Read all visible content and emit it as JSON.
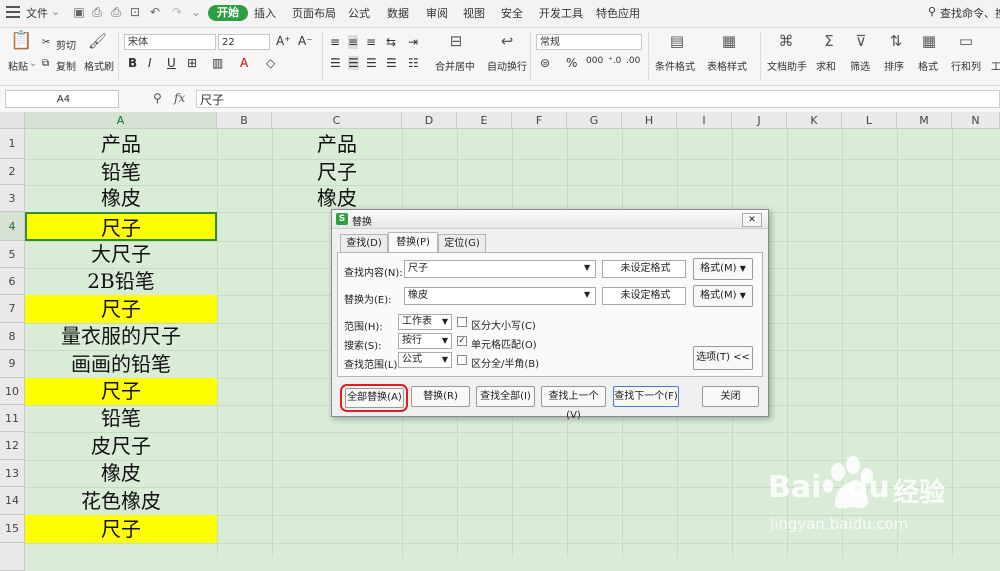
{
  "menubar": {
    "file_label": "文件",
    "tabs": [
      "开始",
      "插入",
      "页面布局",
      "公式",
      "数据",
      "审阅",
      "视图",
      "安全",
      "开发工具",
      "特色应用"
    ],
    "search_label": "查找命令、搜"
  },
  "ribbon": {
    "paste": "粘贴",
    "cut": "剪切",
    "copy": "复制",
    "format_painter": "格式刷",
    "font_name": "宋体",
    "font_size": "22",
    "merge_center": "合并居中",
    "wrap_text": "自动换行",
    "number_format": "常规",
    "conditional_format": "条件格式",
    "table_style": "表格样式",
    "doc_helper": "文档助手",
    "sum": "求和",
    "filter": "筛选",
    "sort": "排序",
    "format": "格式",
    "rows_cols": "行和列",
    "tools": "工"
  },
  "formula_bar": {
    "name_box": "A4",
    "fx": "fx",
    "content": "尺子"
  },
  "grid": {
    "columns": [
      "A",
      "B",
      "C",
      "D",
      "E",
      "F",
      "G",
      "H",
      "I",
      "J",
      "K",
      "L",
      "M",
      "N"
    ],
    "rows": [
      "1",
      "2",
      "3",
      "4",
      "5",
      "6",
      "7",
      "8",
      "9",
      "10",
      "11",
      "12",
      "13",
      "14",
      "15",
      ""
    ],
    "col_a": [
      "产品",
      "铅笔",
      "橡皮",
      "尺子",
      "大尺子",
      "2B铅笔",
      "尺子",
      "量衣服的尺子",
      "画画的铅笔",
      "尺子",
      "铅笔",
      "皮尺子",
      "橡皮",
      "花色橡皮",
      "尺子"
    ],
    "col_c": [
      "产品",
      "尺子",
      "橡皮"
    ],
    "highlight_color": "#ffff00",
    "selected_cell": "A4"
  },
  "dialog": {
    "title": "替换",
    "tabs": [
      "查找(D)",
      "替换(P)",
      "定位(G)"
    ],
    "find_label": "查找内容(N):",
    "find_value": "尺子",
    "replace_label": "替换为(E):",
    "replace_value": "橡皮",
    "no_format": "未设定格式",
    "format_btn": "格式(M)",
    "scope_label": "范围(H):",
    "scope_value": "工作表",
    "search_label": "搜索(S):",
    "search_value": "按行",
    "lookin_label": "查找范围(L):",
    "lookin_value": "公式",
    "match_case": "区分大小写(C)",
    "match_cell": "单元格匹配(O)",
    "match_width": "区分全/半角(B)",
    "options_btn": "选项(T) <<",
    "replace_all": "全部替换(A)",
    "replace": "替换(R)",
    "find_all": "查找全部(I)",
    "find_prev": "查找上一个(V)",
    "find_next": "查找下一个(F)",
    "close": "关闭",
    "close_icon": "✕"
  },
  "watermark": {
    "brand": "Bai",
    "brand2": "du",
    "suffix": "经验",
    "url": "jingyan.baidu.com"
  }
}
